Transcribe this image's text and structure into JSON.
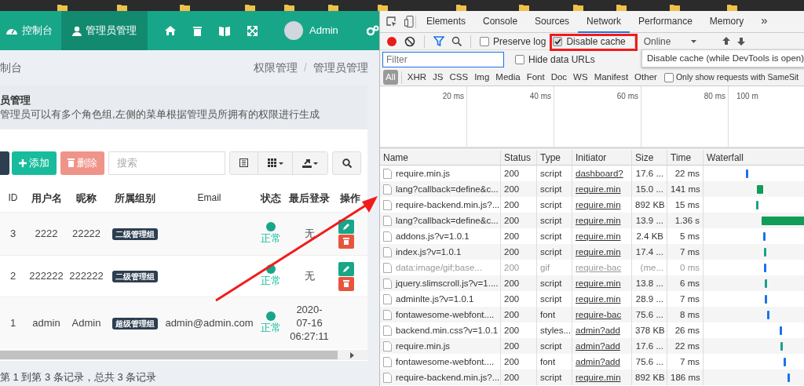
{
  "app": {
    "nav": [
      {
        "label": "控制台",
        "selected": false
      },
      {
        "label": "管理员管理",
        "selected": true
      }
    ],
    "user": "Admin",
    "breadcrumb": {
      "current": "制台",
      "trail": [
        "权限管理",
        "/",
        "管理员管理"
      ]
    },
    "panel": {
      "title": "员管理",
      "description": "管理员可以有多个角色组,左侧的菜单根据管理员所拥有的权限进行生成"
    },
    "toolbar": {
      "buttons": [
        {
          "label": "添加",
          "kind": "add",
          "disabled": false
        },
        {
          "label": "删除",
          "kind": "delete",
          "disabled": true
        }
      ],
      "search": {
        "placeholder": "搜索"
      }
    },
    "table": {
      "columns": [
        "ID",
        "用户名",
        "昵称",
        "所属组别",
        "Email",
        "状态",
        "最后登录",
        "操作"
      ],
      "rows": [
        {
          "id": "3",
          "username": "2222",
          "nickname": "22222",
          "group": "二级管理组",
          "status": "正常",
          "last_login": "无",
          "actions": true
        },
        {
          "id": "2",
          "username": "222222",
          "nickname": "222222",
          "group": "二级管理组",
          "status": "正常",
          "last_login": "无",
          "actions": true
        },
        {
          "id": "1",
          "username": "admin",
          "nickname": "Admin",
          "group": "超级管理组",
          "email": "admin@admin.com",
          "status": "正常",
          "last_login": "2020-07-16 06:27:11",
          "actions": false
        }
      ]
    },
    "footer": "第 1 到第 3 条记录，总共 3 条记录"
  },
  "devtools": {
    "tabs": [
      {
        "label": "Elements",
        "selected": false
      },
      {
        "label": "Console",
        "selected": false
      },
      {
        "label": "Sources",
        "selected": false
      },
      {
        "label": "Network",
        "selected": true
      },
      {
        "label": "Performance",
        "selected": false
      },
      {
        "label": "Memory",
        "selected": false
      }
    ],
    "more": "»",
    "options": [
      {
        "label": "Preserve log",
        "checked": false
      },
      {
        "label": "Disable cache",
        "checked": true
      }
    ],
    "throttle": "Online",
    "tooltip": "Disable cache (while DevTools is open)",
    "filter": {
      "placeholder": "Filter"
    },
    "hide_data_urls": {
      "label": "Hide data URLs",
      "checked": false
    },
    "types": [
      {
        "label": "All",
        "selected": true
      },
      {
        "label": "XHR",
        "selected": false
      },
      {
        "label": "JS",
        "selected": false
      },
      {
        "label": "CSS",
        "selected": false
      },
      {
        "label": "Img",
        "selected": false
      },
      {
        "label": "Media",
        "selected": false
      },
      {
        "label": "Font",
        "selected": false
      },
      {
        "label": "Doc",
        "selected": false
      },
      {
        "label": "WS",
        "selected": false
      },
      {
        "label": "Manifest",
        "selected": false
      },
      {
        "label": "Other",
        "selected": false
      }
    ],
    "samesite": {
      "label": "Only show requests with SameSit",
      "checked": false
    },
    "overview_ticks": [
      "20 ms",
      "40 ms",
      "60 ms",
      "80 ms",
      "100 m"
    ],
    "columns": [
      "Name",
      "Status",
      "Type",
      "Initiator",
      "Size",
      "Time",
      "Waterfall"
    ],
    "rows": [
      {
        "name": "require.min.js",
        "status": "200",
        "type": "script",
        "initiator": "dashboard?",
        "size": "17.6 ...",
        "time": "22 ms",
        "greyed": false
      },
      {
        "name": "lang?callback=define&c...",
        "status": "200",
        "type": "script",
        "initiator": "require.min",
        "size": "15.0 ...",
        "time": "141 ms",
        "greyed": false
      },
      {
        "name": "require-backend.min.js?...",
        "status": "200",
        "type": "script",
        "initiator": "require.min",
        "size": "892 KB",
        "time": "15 ms",
        "greyed": false
      },
      {
        "name": "lang?callback=define&c...",
        "status": "200",
        "type": "script",
        "initiator": "require.min",
        "size": "13.9 ...",
        "time": "1.36 s",
        "greyed": false
      },
      {
        "name": "addons.js?v=1.0.1",
        "status": "200",
        "type": "script",
        "initiator": "require.min",
        "size": "2.4 KB",
        "time": "5 ms",
        "greyed": false
      },
      {
        "name": "index.js?v=1.0.1",
        "status": "200",
        "type": "script",
        "initiator": "require.min",
        "size": "17.4 ...",
        "time": "7 ms",
        "greyed": false
      },
      {
        "name": "data:image/gif;base...",
        "status": "200",
        "type": "gif",
        "initiator": "require-bac",
        "size": "(me...",
        "time": "0 ms",
        "greyed": true
      },
      {
        "name": "jquery.slimscroll.js?v=1....",
        "status": "200",
        "type": "script",
        "initiator": "require.min",
        "size": "13.8 ...",
        "time": "6 ms",
        "greyed": false
      },
      {
        "name": "adminlte.js?v=1.0.1",
        "status": "200",
        "type": "script",
        "initiator": "require.min",
        "size": "28.9 ...",
        "time": "7 ms",
        "greyed": false
      },
      {
        "name": "fontawesome-webfont....",
        "status": "200",
        "type": "font",
        "initiator": "require-bac",
        "size": "75.6 ...",
        "time": "8 ms",
        "greyed": false
      },
      {
        "name": "backend.min.css?v=1.0.1",
        "status": "200",
        "type": "styles...",
        "initiator": "admin?add",
        "size": "378 KB",
        "time": "26 ms",
        "greyed": false
      },
      {
        "name": "require.min.js",
        "status": "200",
        "type": "script",
        "initiator": "admin?add",
        "size": "17.6 ...",
        "time": "22 ms",
        "greyed": false
      },
      {
        "name": "fontawesome-webfont....",
        "status": "200",
        "type": "font",
        "initiator": "admin?add",
        "size": "75.6 ...",
        "time": "7 ms",
        "greyed": false
      },
      {
        "name": "require-backend.min.js?...",
        "status": "200",
        "type": "script",
        "initiator": "require.min",
        "size": "892 KB",
        "time": "186 ms",
        "greyed": false
      }
    ]
  }
}
